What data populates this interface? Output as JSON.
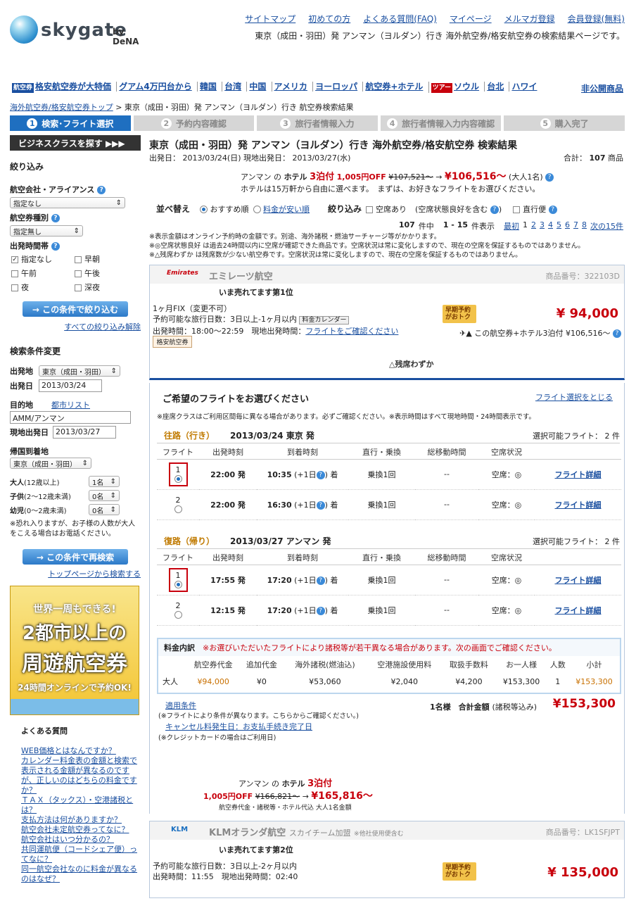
{
  "header": {
    "logo_text": "skygate",
    "logo_by": "by DeNA",
    "links": [
      "サイトマップ",
      "初めての方",
      "よくある質問(FAQ)",
      "マイページ",
      "メルマガ登録",
      "会員登録(無料)"
    ],
    "tagline": "東京（成田・羽田）発 アンマン（ヨルダン）行き 海外航空券/格安航空券の検索結果ページです。"
  },
  "promo": {
    "tag": "航空券",
    "tag2": "ツアー",
    "items": [
      "格安航空券が大特価",
      "グアム4万円台から",
      "韓国",
      "台湾",
      "中国",
      "アメリカ",
      "ヨーロッパ",
      "航空券+ホテル",
      "ソウル",
      "台北",
      "ハワイ"
    ],
    "right": "非公開商品"
  },
  "breadcrumb": {
    "home": "海外航空券/格安航空券トップ",
    "current": " > 東京（成田・羽田）発 アンマン（ヨルダン）行き 航空券検索結果"
  },
  "steps": [
    {
      "num": "1",
      "label": "検索･フライト選択"
    },
    {
      "num": "2",
      "label": "予約内容確認"
    },
    {
      "num": "3",
      "label": "旅行者情報入力"
    },
    {
      "num": "4",
      "label": "旅行者情報入力内容確認"
    },
    {
      "num": "5",
      "label": "購入完了"
    }
  ],
  "sidebar": {
    "biz_button": "ビジネスクラスを探す ▶▶▶",
    "filter_head": "絞り込み",
    "airline_label": "航空会社・アライアンス",
    "airline_value": "指定なし",
    "ticket_label": "航空券種別",
    "ticket_value": "指定無し",
    "time_label": "出発時間帯",
    "time_opts": [
      "指定なし",
      "早朝",
      "午前",
      "午後",
      "夜",
      "深夜"
    ],
    "filter_btn": "→ この条件で絞り込む",
    "clear_link": "すべての絞り込み解除",
    "search_head": "検索条件変更",
    "dep_label": "出発地",
    "dep_value": "東京（成田・羽田）",
    "depdate_label": "出発日",
    "depdate_value": "2013/03/24",
    "dest_label": "目的地",
    "dest_link": "都市リスト",
    "dest_value": "AMM/アンマン",
    "localdate_label": "現地出発日",
    "localdate_value": "2013/03/27",
    "return_label": "帰国到着地",
    "return_value": "東京（成田・羽田）",
    "adult_label": "大人",
    "adult_note": "(12歳以上)",
    "adult_value": "1名",
    "child_label": "子供",
    "child_note": "(2〜12歳未満)",
    "child_value": "0名",
    "infant_label": "幼児",
    "infant_note": "(0〜2歳未満)",
    "infant_value": "0名",
    "pax_note": "※恐れ入りますが、お子様の人数が大人をこえる場合はお電話ください。",
    "research_btn": "→ この条件で再検索",
    "top_link": "トップページから検索する",
    "banner_line1": "世界一周もできる!",
    "banner_line2": "2都市以上の",
    "banner_line3": "周遊航空券",
    "banner_line4": "24時間オンラインで予約OK!",
    "faq_head": "よくある質問",
    "faq": [
      "WEB価格とはなんですか？",
      "カレンダー料金表の金額と検索で表示される金額が異なるのですが、正しいのはどちらの料金ですか？",
      "ＴＡＸ（タックス）・空港諸税とは？",
      "支払方法は何がありますか？",
      "航空会社未定航空券ってなに？",
      "航空会社はいつ分かるの？",
      "共同運航便（コードシェア便）ってなに？",
      "同一航空会社なのに料金が異なるのはなぜ？"
    ]
  },
  "main": {
    "title": "東京（成田・羽田）発 アンマン（ヨルダン）行き 海外航空券/格安航空券 検索結果",
    "dates": "出発日： 2013/03/24(日) 現地出発日： 2013/03/27(水)",
    "total_label": "合計：",
    "total_value": "107",
    "total_unit": "商品",
    "hotel_promo": {
      "city": "アンマン の",
      "hotel": "ホテル",
      "nights": "3泊付",
      "off": "1,005円OFF",
      "old": "¥107,521〜",
      "arrow": "→",
      "new": "¥106,516〜",
      "pax": "(大人1名)"
    },
    "hotel_sub": "ホテルは15万軒から自由に選べます。　まずは、お好きなフライトをお選びください。",
    "sort_label": "並べ替え",
    "sort_opt1": "おすすめ順",
    "sort_opt2": "料金が安い順",
    "filter_label": "絞り込み",
    "filter_opt1": "空席あり",
    "filter_opt2": "(空席状態良好を含む",
    "filter_opt3": "直行便",
    "pager": {
      "count": "107",
      "count_unit": "件中",
      "range": "1 - 15",
      "range_unit": "件表示",
      "first": "最初",
      "pages": [
        "1",
        "2",
        "3",
        "4",
        "5",
        "6",
        "7",
        "8"
      ],
      "next": "次の15件"
    },
    "notes": [
      "※表示金額はオンライン予約時の金額です。別途、海外諸税・燃油サーチャージ等がかかります。",
      "※◎空席状態良好 は過去24時間以内に空席が確認できた商品です。空席状況は常に変化しますので、現在の空席を保証するものではありません。",
      "※△残席わずか は残席数が少ない航空券です。空席状況は常に変化しますので、現在の空席を保証するものではありません。"
    ],
    "note_badge1": "空席状態良好",
    "note_badge2": "残席わずか",
    "card1": {
      "airline": "エミレーツ航空",
      "airline_logo": "Emirates",
      "product_no": "商品番号：322103D",
      "rank": "いま売れてます第1位",
      "ticket_type": "1ヶ月FIX（変更不可）",
      "period": "予約可能な旅行日数：3日以上-1ヶ月以内",
      "cal_btn": "料金カレンダー",
      "times": "出発時間：18:00〜22:59　現地出発時間：",
      "times_link": "フライトをご確認ください",
      "tag": "格安航空券",
      "early": "早期予約がおトク",
      "price": "¥ 94,000",
      "combo": "この航空券+ホテル3泊付 ¥106,516〜",
      "seat": "△残席わずか"
    },
    "select": {
      "head": "ご希望のフライトをお選びください",
      "close": "フライト選択をとじる",
      "note": "※座席クラスはご利用区間毎に異なる場合があります。必ずご確認ください。※表示時間はすべて現地時間・24時間表示です。",
      "out_label": "往路（行き）",
      "out_info": "2013/03/24 東京 発",
      "out_avail": "選択可能フライト： 2 件",
      "ret_label": "復路（帰り）",
      "ret_info": "2013/03/27 アンマン 発",
      "ret_avail": "選択可能フライト： 2 件",
      "cols": [
        "フライト",
        "出発時刻",
        "到着時刻",
        "直行・乗換",
        "総移動時間",
        "空席状況"
      ],
      "out_rows": [
        {
          "no": "1",
          "dep": "22:00 発",
          "arr": "10:35",
          "plus": "(+1日",
          "arr_suffix": "着",
          "type": "乗換1回",
          "dur": "--",
          "seat": "空席：◎",
          "link": "フライト詳細"
        },
        {
          "no": "2",
          "dep": "22:00 発",
          "arr": "16:30",
          "plus": "(+1日",
          "arr_suffix": "着",
          "type": "乗換1回",
          "dur": "--",
          "seat": "空席：◎",
          "link": "フライト詳細"
        }
      ],
      "ret_rows": [
        {
          "no": "1",
          "dep": "17:55 発",
          "arr": "17:20",
          "plus": "(+1日",
          "arr_suffix": "着",
          "type": "乗換1回",
          "dur": "--",
          "seat": "空席：◎",
          "link": "フライト詳細"
        },
        {
          "no": "2",
          "dep": "12:15 発",
          "arr": "17:20",
          "plus": "(+1日",
          "arr_suffix": "着",
          "type": "乗換1回",
          "dur": "--",
          "seat": "空席：◎",
          "link": "フライト詳細"
        }
      ],
      "fare_head": "料金内訳",
      "fare_warn": "※お選びいただいたフライトにより諸税等が若干異なる場合があります。次の画面でご確認ください。",
      "fare_cols": [
        "航空券代金",
        "追加代金",
        "海外諸税(燃油込)",
        "空港施設使用料",
        "取扱手数料",
        "お一人様",
        "人数",
        "小計"
      ],
      "fare_row": {
        "pax": "大人",
        "ticket": "¥94,000",
        "extra": "¥0",
        "tax": "¥53,060",
        "airport": "¥2,040",
        "fee": "¥4,200",
        "per": "¥153,300",
        "count": "1",
        "subtotal": "¥153,300"
      },
      "cond_link": "適用条件",
      "cond_note": "(※フライトにより条件が異なります。こちらからご確認ください。)",
      "total_label": "1名様　合計金額",
      "total_tax": "(諸税等込み)",
      "total_value": "¥153,300",
      "cancel_link": "キャンセル料発生日：お支払手続き完了日",
      "cancel_note": "(※クレジットカードの場合はご利用日)",
      "hotel2_city": "アンマン の",
      "hotel2_hotel": "ホテル",
      "hotel2_nights": "3泊付",
      "hotel2_off": "1,005円OFF",
      "hotel2_old": "¥166,821〜",
      "hotel2_arrow": "→",
      "hotel2_new": "¥165,816〜",
      "hotel2_sub": "航空券代金・諸税等・ホテル代込 大人1名金額"
    },
    "card2": {
      "airline": "KLMオランダ航空",
      "alliance": "スカイチーム加盟",
      "alliance_note": "※他社使用便含む",
      "logo": "KLM",
      "product_no": "商品番号：LK1SFJPT",
      "rank": "いま売れてます第2位",
      "period": "予約可能な旅行日数：3日以上-2ヶ月以内",
      "times": "出発時間：11:55　現地出発時間：02:40",
      "early": "早期予約がおトク",
      "price": "¥ 135,000"
    }
  }
}
